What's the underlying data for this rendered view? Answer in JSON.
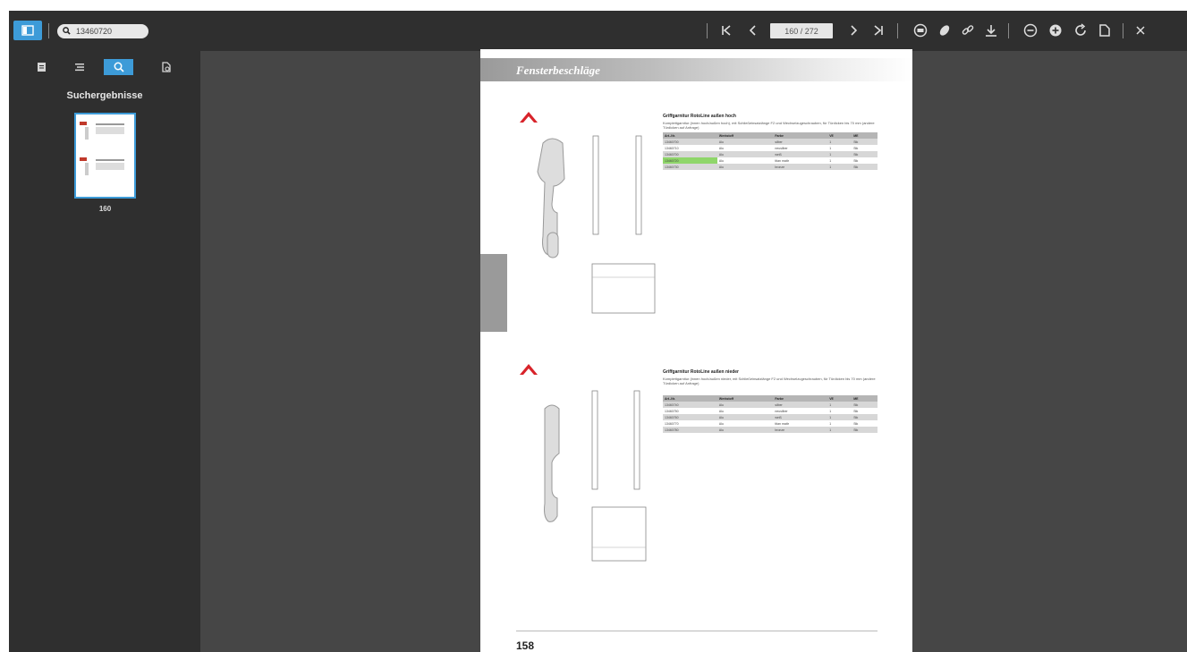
{
  "toolbar": {
    "search_value": "13460720",
    "page_indicator": "160 / 272"
  },
  "sidebar": {
    "tabs": [
      "thumbnails",
      "outline",
      "search",
      "attachments"
    ],
    "active_tab": "search",
    "results_title": "Suchergebnisse",
    "result_page_label": "160"
  },
  "document": {
    "header": "Fensterbeschläge",
    "brand": "Roto",
    "section1": {
      "title": "Griffgarnitur RotoLine außen hoch",
      "description": "Komplettgarnitur (innen hoch/außen hoch), mit Schließeinsatzlänge F2 und Wechselzugeschrauben, für Türdicken bis 70 mm (andere Türdicken auf Anfrage)",
      "columns": [
        "Art.-Nr.",
        "Werkstoff",
        "Farbe",
        "VE",
        "ME"
      ],
      "rows": [
        [
          "13460700",
          "Alu",
          "silber",
          "1",
          "Stk"
        ],
        [
          "13460710",
          "Alu",
          "neusilber",
          "1",
          "Stk"
        ],
        [
          "13460700",
          "Alu",
          "weiß",
          "1",
          "Stk"
        ],
        [
          "13460720",
          "Alu",
          "titan mattr",
          "1",
          "Stk"
        ],
        [
          "13460730",
          "Alu",
          "bronze",
          "1",
          "Stk"
        ]
      ],
      "highlight_row": 3
    },
    "section2": {
      "title": "Griffgarnitur RotoLine außen nieder",
      "description": "Komplettgarnitur (innen hoch/außen nieder, mit Schließeinsatzlänge F2 und Wechselzugeschrauben, für Türdicken bis 70 mm (andere Türdicken auf Anfrage)",
      "columns": [
        "Art.-Nr.",
        "Werkstoff",
        "Farbe",
        "VE",
        "ME"
      ],
      "rows": [
        [
          "13460740",
          "Alu",
          "silber",
          "1",
          "Stk"
        ],
        [
          "13460750",
          "Alu",
          "neusilber",
          "1",
          "Stk"
        ],
        [
          "13460760",
          "Alu",
          "weiß",
          "1",
          "Stk"
        ],
        [
          "13460770",
          "Alu",
          "titan mattr",
          "1",
          "Stk"
        ],
        [
          "13460780",
          "Alu",
          "bronze",
          "1",
          "Stk"
        ]
      ]
    },
    "page_number": "158"
  },
  "colors": {
    "accent": "#3d9bd8",
    "highlight": "#8fd66a",
    "toolbar_bg": "#2f2f2f",
    "canvas_bg": "#464646"
  }
}
